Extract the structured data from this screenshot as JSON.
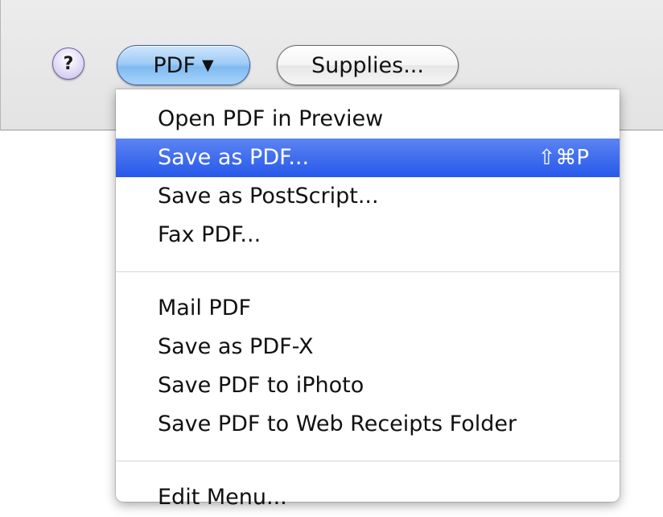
{
  "toolbar": {
    "help_label": "?",
    "pdf_label": "PDF",
    "pdf_caret": "▼",
    "supplies_label": "Supplies..."
  },
  "menu": {
    "items_group1": [
      {
        "label": "Open PDF in Preview"
      },
      {
        "label": "Save as PDF...",
        "shortcut": "⇧⌘P",
        "highlighted": true
      },
      {
        "label": "Save as PostScript..."
      },
      {
        "label": "Fax PDF..."
      }
    ],
    "items_group2": [
      {
        "label": "Mail PDF"
      },
      {
        "label": "Save as PDF-X"
      },
      {
        "label": "Save PDF to iPhoto"
      },
      {
        "label": "Save PDF to Web Receipts Folder"
      }
    ],
    "items_group3": [
      {
        "label": "Edit Menu..."
      }
    ]
  },
  "colors": {
    "highlight": "#2d5ceb",
    "pdf_button": "#8cc3f4"
  }
}
